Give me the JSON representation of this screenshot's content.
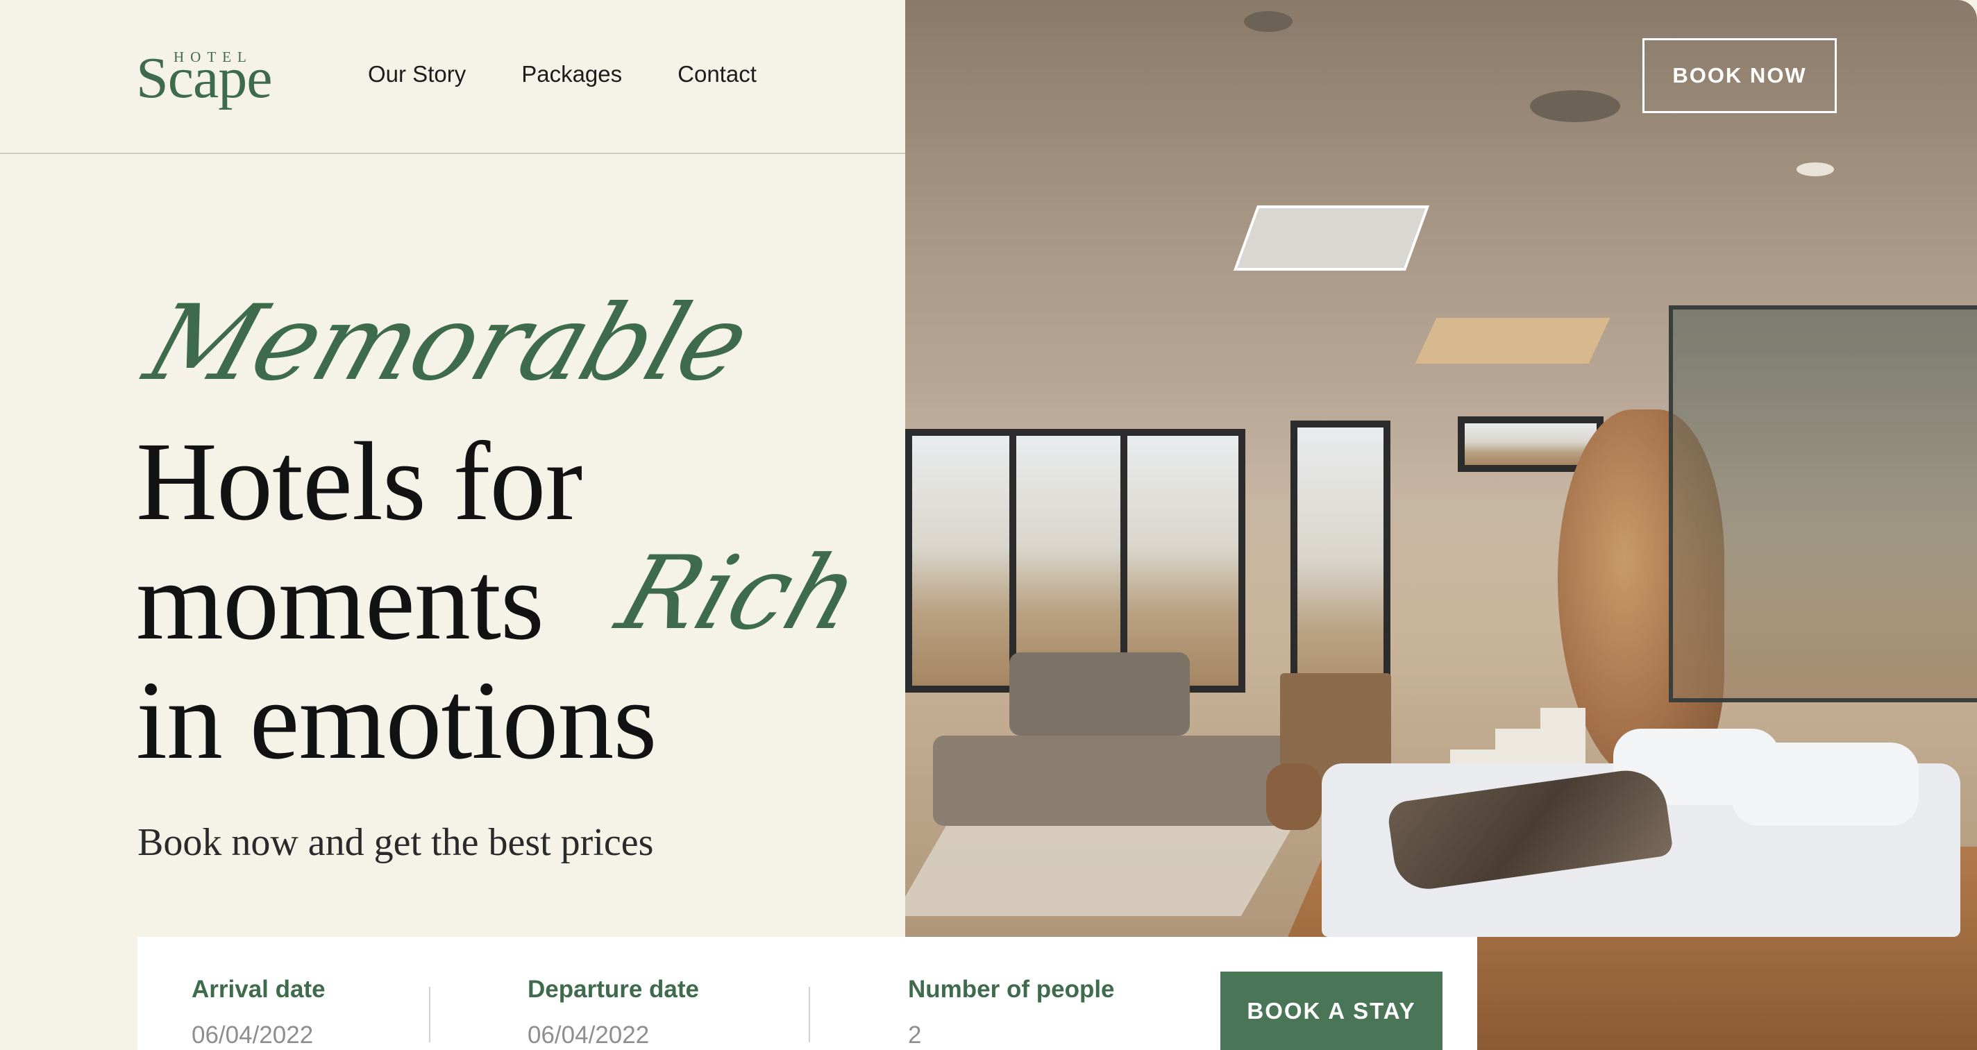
{
  "brand": {
    "logo_small": "HOTEL",
    "logo_big": "Scape"
  },
  "nav": {
    "items": [
      "Our Story",
      "Packages",
      "Contact"
    ],
    "book_now_label": "BOOK NOW"
  },
  "hero": {
    "script_top": "Memorable",
    "headline_line1": "Hotels for",
    "headline_line2": "moments",
    "script_inline": "Rich",
    "headline_line3": "in emotions",
    "subtitle": "Book now and get the best prices"
  },
  "booking": {
    "arrival": {
      "label": "Arrival date",
      "value": "06/04/2022"
    },
    "departure": {
      "label": "Departure date",
      "value": "06/04/2022"
    },
    "people": {
      "label": "Number of people",
      "value": "2"
    },
    "submit_label": "BOOK A STAY"
  },
  "colors": {
    "background": "#f5f2e8",
    "accent_green": "#3d6b4c",
    "button_green": "#4a7657",
    "text_dark": "#121212"
  }
}
